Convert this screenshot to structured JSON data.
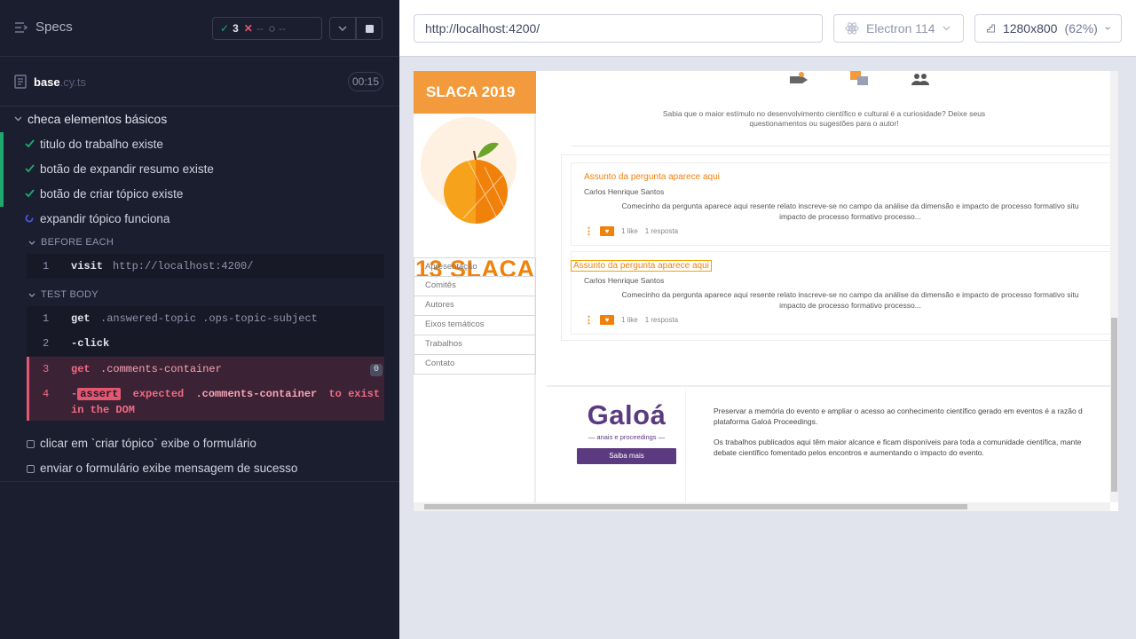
{
  "header": {
    "title": "Specs",
    "stats": {
      "passed": "3",
      "failed": "--",
      "pending": "--"
    }
  },
  "spec_file": {
    "name": "base",
    "ext": ".cy.ts",
    "duration": "00:15"
  },
  "suite": {
    "title": "checa elementos básicos",
    "tests": [
      {
        "title": "titulo do trabalho existe",
        "state": "passed"
      },
      {
        "title": "botão de expandir resumo existe",
        "state": "passed"
      },
      {
        "title": "botão de criar tópico existe",
        "state": "passed"
      },
      {
        "title": "expandir tópico funciona",
        "state": "running"
      }
    ],
    "before_each_label": "BEFORE EACH",
    "before_each": [
      {
        "n": "1",
        "name": "visit",
        "arg": "http://localhost:4200/"
      }
    ],
    "test_body_label": "TEST BODY",
    "test_body": [
      {
        "n": "1",
        "name": "get",
        "arg": ".answered-topic .ops-topic-subject"
      },
      {
        "n": "2",
        "name": "-click",
        "arg": ""
      },
      {
        "n": "3",
        "name": "get",
        "arg": ".comments-container",
        "badge": "0"
      },
      {
        "n": "4",
        "prefix": "-",
        "name": "assert",
        "arg1": "expected",
        "arg2": ".comments-container",
        "arg3": "to exist",
        "arg4": "in the DOM"
      }
    ],
    "pending_tests": [
      {
        "title": "clicar em `criar tópico` exibe o formulário"
      },
      {
        "title": "enviar o formulário exibe mensagem de sucesso"
      }
    ]
  },
  "browser_bar": {
    "url": "http://localhost:4200/",
    "browser": "Electron 114",
    "viewport": "1280x800",
    "scale": "(62%)"
  },
  "site": {
    "header": "SLACA 2019",
    "logo_text": "13 SLACA",
    "nav": [
      "Apresentação",
      "Comitês",
      "Autores",
      "Eixos temáticos",
      "Trabalhos",
      "Contato"
    ],
    "note_line1": "Sabia que o maior estímulo no desenvolvimento científico e cultural é a curiosidade? Deixe seus",
    "note_line2": "questionamentos ou sugestões para o autor!",
    "topics": [
      {
        "subject": "Assunto da pergunta aparece aqui",
        "author": "Carlos Henrique Santos",
        "body1": "Comecinho da pergunta aparece aqui resente relato inscreve-se no campo da análise da dimensão e impacto de processo formativo situ",
        "body2": "impacto de processo formativo processo...",
        "likes": "1 like",
        "replies": "1 resposta"
      },
      {
        "subject": "Assunto da pergunta aparece aqui",
        "author": "Carlos Henrique Santos",
        "body1": "Comecinho da pergunta aparece aqui resente relato inscreve-se no campo da análise da dimensão e impacto de processo formativo situ",
        "body2": "impacto de processo formativo processo...",
        "likes": "1 like",
        "replies": "1 resposta"
      }
    ],
    "galoa_title": "Galoá",
    "galoa_sub": "anais e proceedings",
    "galoa_button": "Saiba mais",
    "footer_p1a": "Preservar a memória do evento e ampliar o acesso ao conhecimento científico gerado em eventos é a razão d",
    "footer_p1b": "plataforma Galoá Proceedings.",
    "footer_p2a": "Os trabalhos publicados aqui têm maior alcance e ficam disponíveis para toda a comunidade científica, mante",
    "footer_p2b": "debate científico fomentado pelos encontros e aumentando o impacto do evento."
  },
  "colors": {
    "pass": "#1fa971",
    "fail": "#e45770",
    "accent_orange": "#f0820c",
    "galoa_purple": "#5b3a7f"
  }
}
